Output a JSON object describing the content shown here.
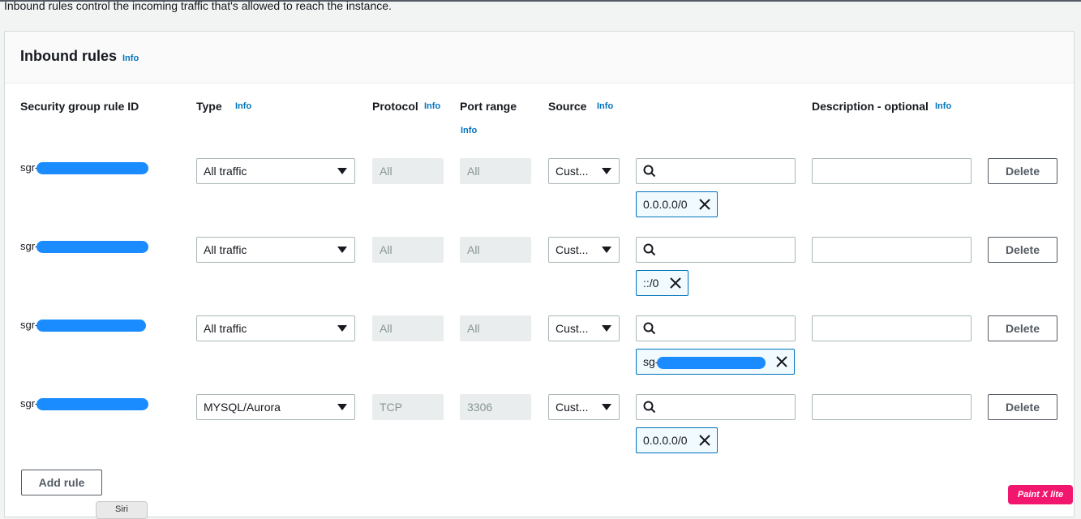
{
  "intro_text": "Inbound rules control the incoming traffic that's allowed to reach the instance.",
  "panel": {
    "title": "Inbound rules",
    "info": "Info"
  },
  "columns": {
    "rule_id": "Security group rule ID",
    "type": "Type",
    "protocol": "Protocol",
    "port_range": "Port range",
    "source": "Source",
    "description": "Description - optional",
    "info": "Info"
  },
  "rules": [
    {
      "id_prefix": "sgr-",
      "type": "All traffic",
      "protocol": "All",
      "port_range": "All",
      "source": "Cust...",
      "token": "0.0.0.0/0",
      "delete": "Delete"
    },
    {
      "id_prefix": "sgr-",
      "type": "All traffic",
      "protocol": "All",
      "port_range": "All",
      "source": "Cust...",
      "token": "::/0",
      "delete": "Delete"
    },
    {
      "id_prefix": "sgr-",
      "type": "All traffic",
      "protocol": "All",
      "port_range": "All",
      "source": "Cust...",
      "token": "sg-",
      "delete": "Delete"
    },
    {
      "id_prefix": "sgr-",
      "type": "MYSQL/Aurora",
      "protocol": "TCP",
      "port_range": "3306",
      "source": "Cust...",
      "token": "0.0.0.0/0",
      "delete": "Delete"
    }
  ],
  "add_rule": "Add rule",
  "overlay": {
    "paint_badge": "Paint X lite",
    "siri": "Siri"
  },
  "colors": {
    "link": "#0073bb",
    "token_border": "#0073bb",
    "redaction": "#1a8cff"
  }
}
